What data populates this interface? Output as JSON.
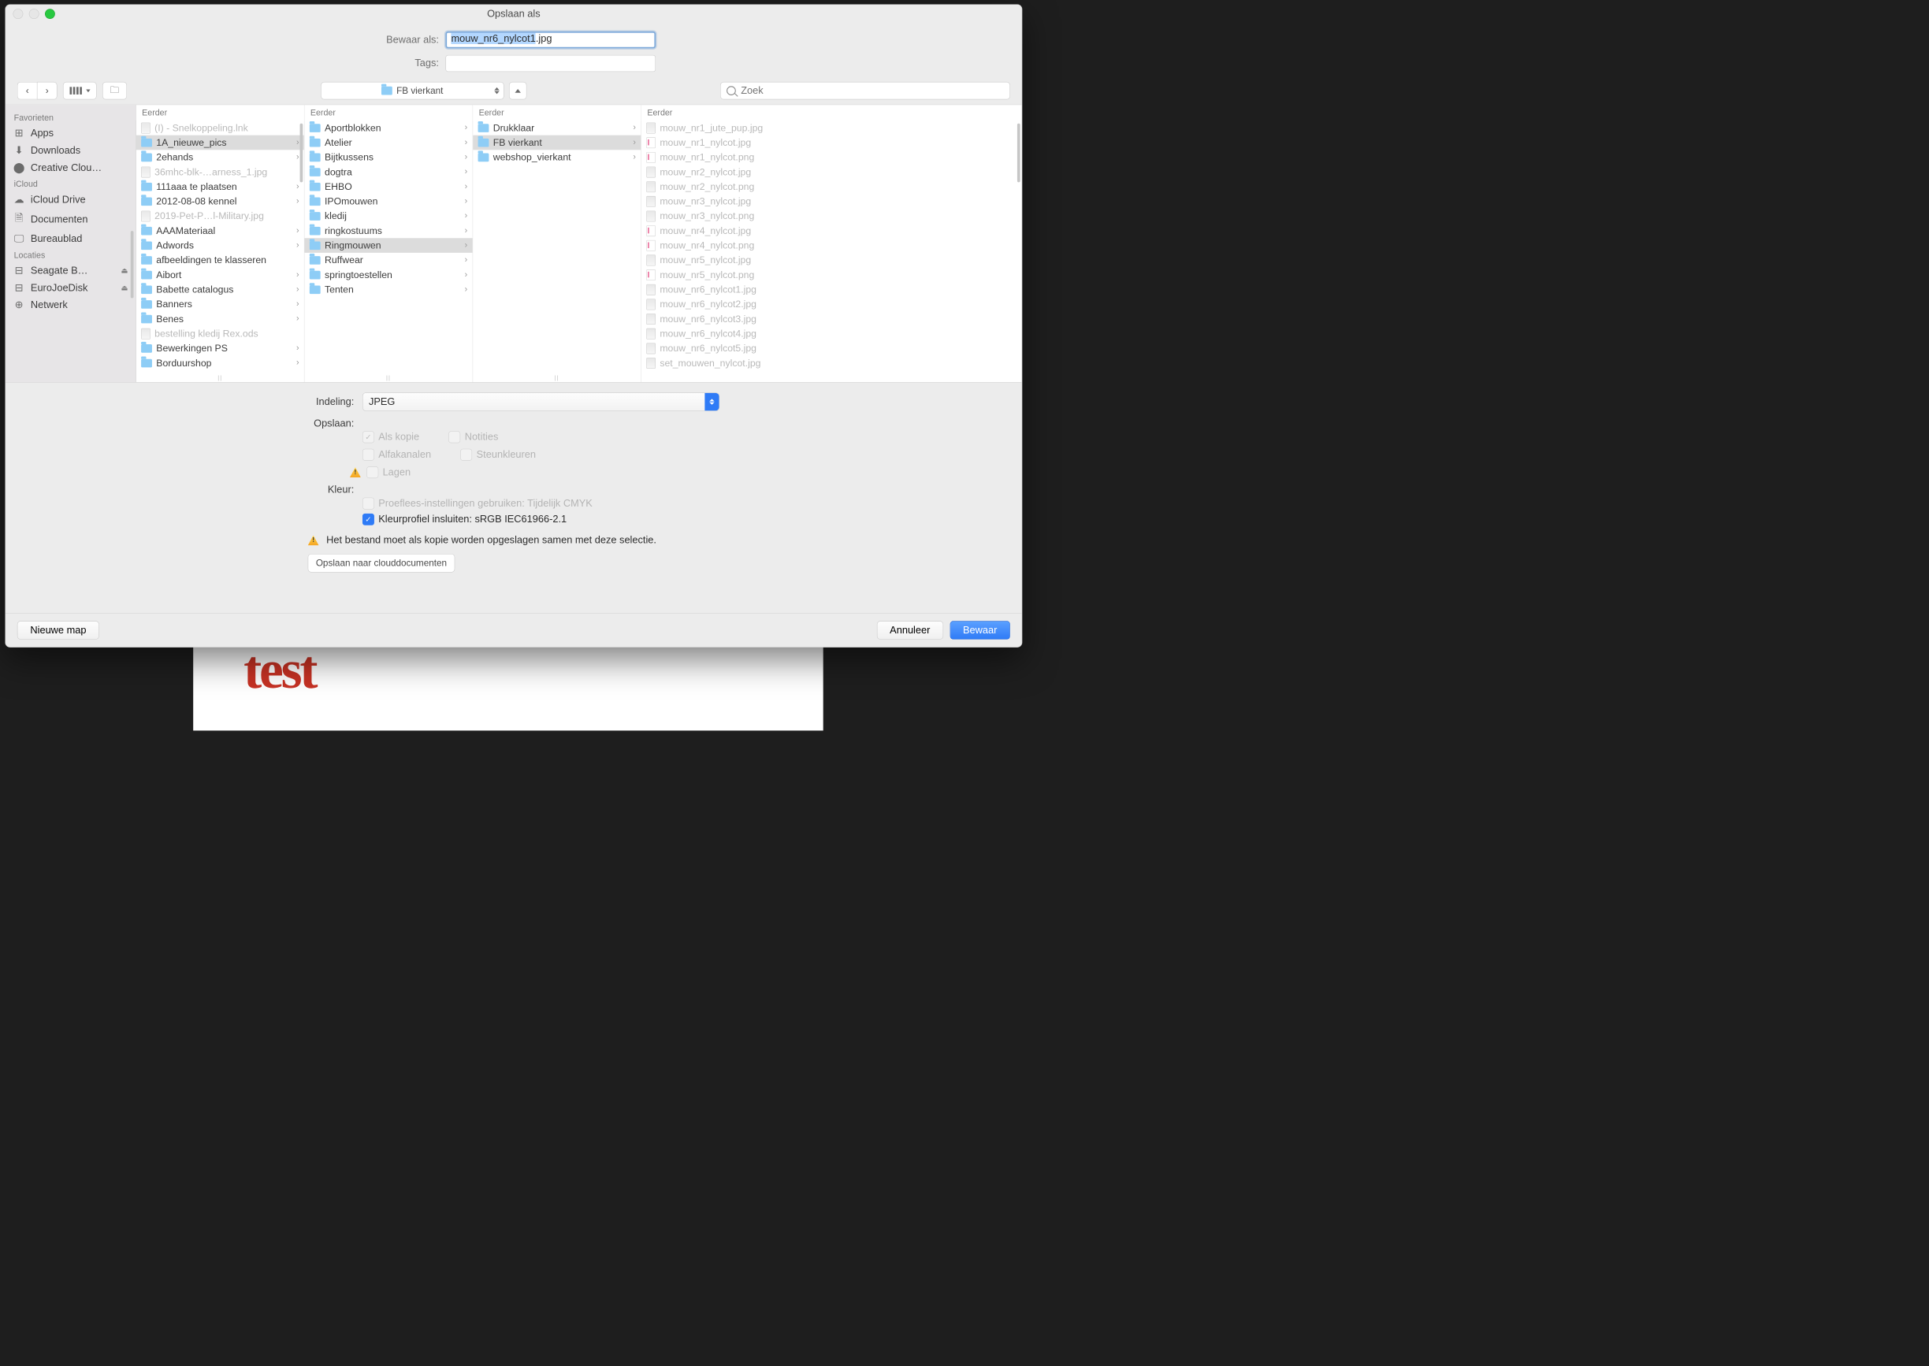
{
  "window": {
    "title": "Opslaan als"
  },
  "fields": {
    "save_as_label": "Bewaar als:",
    "filename_sel": "mouw_nr6_nylcot1",
    "filename_ext": ".jpg",
    "tags_label": "Tags:"
  },
  "path": {
    "current_folder": "FB vierkant"
  },
  "search": {
    "placeholder": "Zoek"
  },
  "sidebar": {
    "groups": [
      {
        "header": "Favorieten",
        "items": [
          {
            "glyph": "⊞",
            "label": "Apps"
          },
          {
            "glyph": "⬇",
            "label": "Downloads"
          },
          {
            "glyph": "⬤",
            "label": "Creative Clou…"
          }
        ]
      },
      {
        "header": "iCloud",
        "items": [
          {
            "glyph": "☁",
            "label": "iCloud Drive"
          },
          {
            "glyph": "🗎",
            "label": "Documenten"
          },
          {
            "glyph": "🖵",
            "label": "Bureaublad"
          }
        ]
      },
      {
        "header": "Locaties",
        "items": [
          {
            "glyph": "⊟",
            "label": "Seagate B…",
            "eject": "⏏"
          },
          {
            "glyph": "⊟",
            "label": "EuroJoeDisk",
            "eject": "⏏"
          },
          {
            "glyph": "⊕",
            "label": "Netwerk"
          }
        ]
      }
    ]
  },
  "columns": [
    {
      "header": "Eerder",
      "items": [
        {
          "type": "doc",
          "label": "(I) - Snelkoppeling.lnk",
          "dim": true
        },
        {
          "type": "folder",
          "label": "1A_nieuwe_pics",
          "chev": true,
          "selected": true
        },
        {
          "type": "folder",
          "label": "2ehands",
          "chev": true
        },
        {
          "type": "doc",
          "label": "36mhc-blk-…arness_1.jpg",
          "dim": true
        },
        {
          "type": "folder",
          "label": "111aaa te plaatsen",
          "chev": true
        },
        {
          "type": "folder",
          "label": "2012-08-08 kennel",
          "chev": true
        },
        {
          "type": "doc",
          "label": "2019-Pet-P…l-Military.jpg",
          "dim": true
        },
        {
          "type": "folder",
          "label": "AAAMateriaal",
          "chev": true
        },
        {
          "type": "folder",
          "label": "Adwords",
          "chev": true
        },
        {
          "type": "folder",
          "label": "afbeeldingen te klasseren"
        },
        {
          "type": "folder",
          "label": "Aibort",
          "chev": true
        },
        {
          "type": "folder",
          "label": "Babette catalogus",
          "chev": true
        },
        {
          "type": "folder",
          "label": "Banners",
          "chev": true
        },
        {
          "type": "folder",
          "label": "Benes",
          "chev": true
        },
        {
          "type": "doc",
          "label": "bestelling kledij Rex.ods",
          "dim": true
        },
        {
          "type": "folder",
          "label": "Bewerkingen PS",
          "chev": true
        },
        {
          "type": "folder",
          "label": "Borduurshop",
          "chev": true
        }
      ]
    },
    {
      "header": "Eerder",
      "items": [
        {
          "type": "folder",
          "label": "Aportblokken",
          "chev": true
        },
        {
          "type": "folder",
          "label": "Atelier",
          "chev": true
        },
        {
          "type": "folder",
          "label": "Bijtkussens",
          "chev": true
        },
        {
          "type": "folder",
          "label": "dogtra",
          "chev": true
        },
        {
          "type": "folder",
          "label": "EHBO",
          "chev": true
        },
        {
          "type": "folder",
          "label": "IPOmouwen",
          "chev": true
        },
        {
          "type": "folder",
          "label": "kledij",
          "chev": true
        },
        {
          "type": "folder",
          "label": "ringkostuums",
          "chev": true
        },
        {
          "type": "folder",
          "label": "Ringmouwen",
          "chev": true,
          "selected": true
        },
        {
          "type": "folder",
          "label": "Ruffwear",
          "chev": true
        },
        {
          "type": "folder",
          "label": "springtoestellen",
          "chev": true
        },
        {
          "type": "folder",
          "label": "Tenten",
          "chev": true
        }
      ]
    },
    {
      "header": "Eerder",
      "items": [
        {
          "type": "folder",
          "label": "Drukklaar",
          "chev": true
        },
        {
          "type": "folder",
          "label": "FB vierkant",
          "chev": true,
          "selected": true
        },
        {
          "type": "folder",
          "label": "webshop_vierkant",
          "chev": true
        }
      ]
    },
    {
      "header": "Eerder",
      "items": [
        {
          "type": "img",
          "label": "mouw_nr1_jute_pup.jpg",
          "dim": true
        },
        {
          "type": "red",
          "label": "mouw_nr1_nylcot.jpg",
          "dim": true
        },
        {
          "type": "red",
          "label": "mouw_nr1_nylcot.png",
          "dim": true
        },
        {
          "type": "img",
          "label": "mouw_nr2_nylcot.jpg",
          "dim": true
        },
        {
          "type": "img",
          "label": "mouw_nr2_nylcot.png",
          "dim": true
        },
        {
          "type": "img",
          "label": "mouw_nr3_nylcot.jpg",
          "dim": true
        },
        {
          "type": "img",
          "label": "mouw_nr3_nylcot.png",
          "dim": true
        },
        {
          "type": "red",
          "label": "mouw_nr4_nylcot.jpg",
          "dim": true
        },
        {
          "type": "red",
          "label": "mouw_nr4_nylcot.png",
          "dim": true
        },
        {
          "type": "img",
          "label": "mouw_nr5_nylcot.jpg",
          "dim": true
        },
        {
          "type": "red",
          "label": "mouw_nr5_nylcot.png",
          "dim": true
        },
        {
          "type": "img",
          "label": "mouw_nr6_nylcot1.jpg",
          "dim": true
        },
        {
          "type": "img",
          "label": "mouw_nr6_nylcot2.jpg",
          "dim": true
        },
        {
          "type": "img",
          "label": "mouw_nr6_nylcot3.jpg",
          "dim": true
        },
        {
          "type": "img",
          "label": "mouw_nr6_nylcot4.jpg",
          "dim": true
        },
        {
          "type": "img",
          "label": "mouw_nr6_nylcot5.jpg",
          "dim": true
        },
        {
          "type": "img",
          "label": "set_mouwen_nylcot.jpg",
          "dim": true
        }
      ]
    }
  ],
  "options": {
    "format_label": "Indeling:",
    "format_value": "JPEG",
    "save_label": "Opslaan:",
    "as_copy": "Als kopie",
    "notes": "Notities",
    "alpha": "Alfakanalen",
    "spot": "Steunkleuren",
    "layers": "Lagen",
    "color_label": "Kleur:",
    "proof": "Proeflees-instellingen gebruiken: Tijdelijk CMYK",
    "embed_profile": "Kleurprofiel insluiten: sRGB IEC61966-2.1",
    "warning_msg": "Het bestand moet als kopie worden opgeslagen samen met deze selectie.",
    "cloud_btn": "Opslaan naar clouddocumenten"
  },
  "footer": {
    "new_folder": "Nieuwe map",
    "cancel": "Annuleer",
    "save": "Bewaar"
  },
  "background": {
    "test": "test"
  }
}
